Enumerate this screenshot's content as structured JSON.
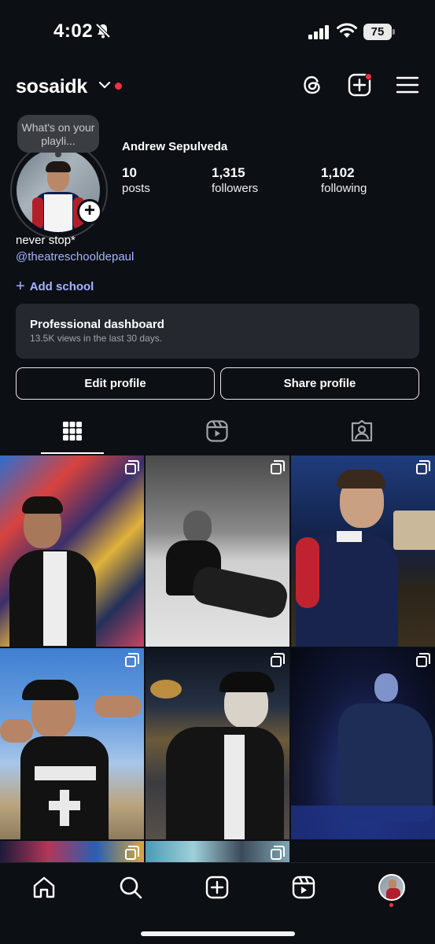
{
  "status_bar": {
    "time": "4:02",
    "battery": "75"
  },
  "header": {
    "username": "sosaidk"
  },
  "profile": {
    "note": "What's on your playli...",
    "full_name": "Andrew Sepulveda",
    "stats": [
      {
        "num": "10",
        "label": "posts"
      },
      {
        "num": "1,315",
        "label": "followers"
      },
      {
        "num": "1,102",
        "label": "following"
      }
    ],
    "bio": "never stop*",
    "bio_link": "@theatreschooldepaul",
    "add_school": "Add school"
  },
  "dashboard": {
    "title": "Professional dashboard",
    "subtitle": "13.5K views in the last 30 days."
  },
  "buttons": {
    "edit": "Edit profile",
    "share": "Share profile"
  },
  "tabs": [
    "grid-icon",
    "reels-icon",
    "tagged-icon"
  ],
  "colors": {
    "background": "#0c0f14",
    "link": "#a4b5ff",
    "notification": "#ff3040",
    "card": "#25282e"
  },
  "grid_posts": [
    {
      "tile": "graffiti wall, black leather jacket",
      "multi": true
    },
    {
      "tile": "black and white beach portrait",
      "multi": true
    },
    {
      "tile": "night street, red and navy jersey",
      "multi": true
    },
    {
      "tile": "blue sky, LIFEGUARD tank top",
      "multi": true
    },
    {
      "tile": "street at night, skull face paint",
      "multi": true
    },
    {
      "tile": "stage performance, blue lighting",
      "multi": true
    },
    {
      "tile": "colourful lights",
      "multi": true
    },
    {
      "tile": "outdoor scene",
      "multi": true
    }
  ],
  "bottom_nav": [
    "home-icon",
    "search-icon",
    "create-icon",
    "reels-icon",
    "profile-avatar"
  ]
}
